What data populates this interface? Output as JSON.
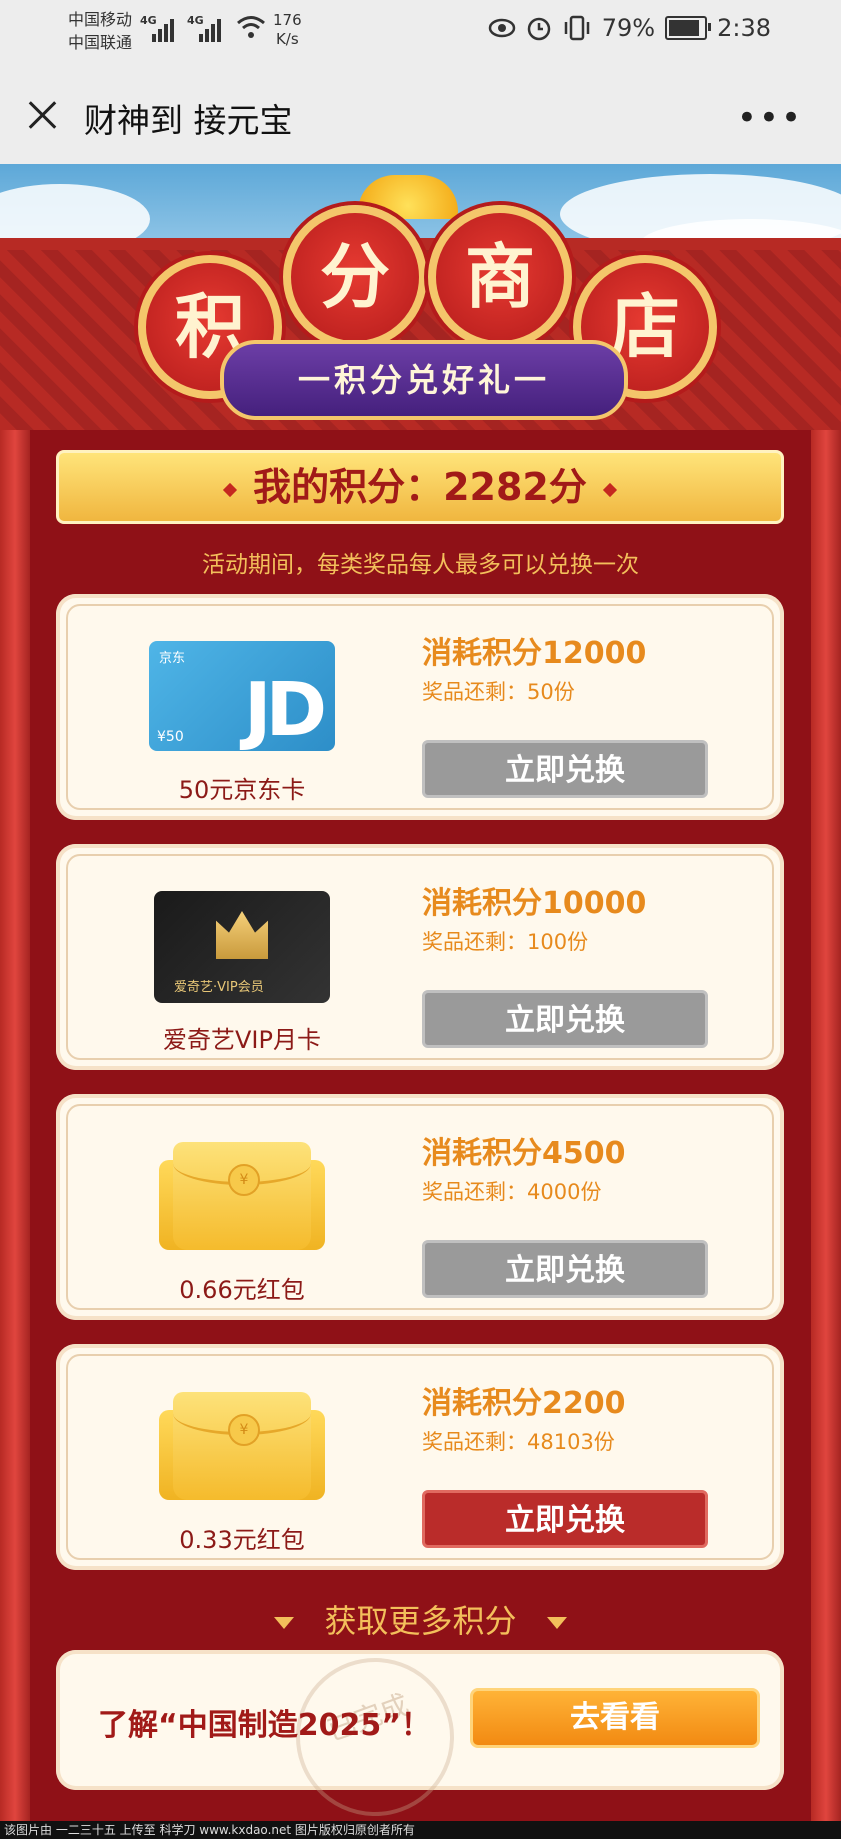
{
  "status": {
    "carrier_top": "中国移动",
    "carrier_bottom": "中国联通",
    "net_tag_1": "4G",
    "net_tag_2": "4G",
    "speed_value": "176",
    "speed_unit": "K/s",
    "battery": "79%",
    "time": "2:38"
  },
  "titlebar": {
    "title": "财神到 接元宝",
    "more": "•••"
  },
  "header": {
    "chars": [
      "积",
      "分",
      "商",
      "店"
    ],
    "banner": "一积分兑好礼一"
  },
  "points": {
    "label": "我的积分：2282分"
  },
  "rule": "活动期间，每类奖品每人最多可以兑换一次",
  "prizes": [
    {
      "name": "50元京东卡",
      "cost": "消耗积分12000",
      "stock": "奖品还剩：50份",
      "button": "立即兑换"
    },
    {
      "name": "爱奇艺VIP月卡",
      "cost": "消耗积分10000",
      "stock": "奖品还剩：100份",
      "button": "立即兑换"
    },
    {
      "name": "0.66元红包",
      "cost": "消耗积分4500",
      "stock": "奖品还剩：4000份",
      "button": "立即兑换"
    },
    {
      "name": "0.33元红包",
      "cost": "消耗积分2200",
      "stock": "奖品还剩：48103份",
      "button": "立即兑换"
    }
  ],
  "jd_card": {
    "logo": "京东",
    "text": "JD",
    "value": "¥50"
  },
  "iqiyi_card": {
    "label": "爱奇艺·VIP会员"
  },
  "envelope_symbol": "¥",
  "more": {
    "title": "获取更多积分"
  },
  "task": {
    "text": "了解“中国制造2025”！",
    "stamp": "已完成",
    "button": "去看看"
  },
  "footer": "该图片由 一二三十五 上传至 科学刀 www.kxdao.net 图片版权归原创者所有"
}
